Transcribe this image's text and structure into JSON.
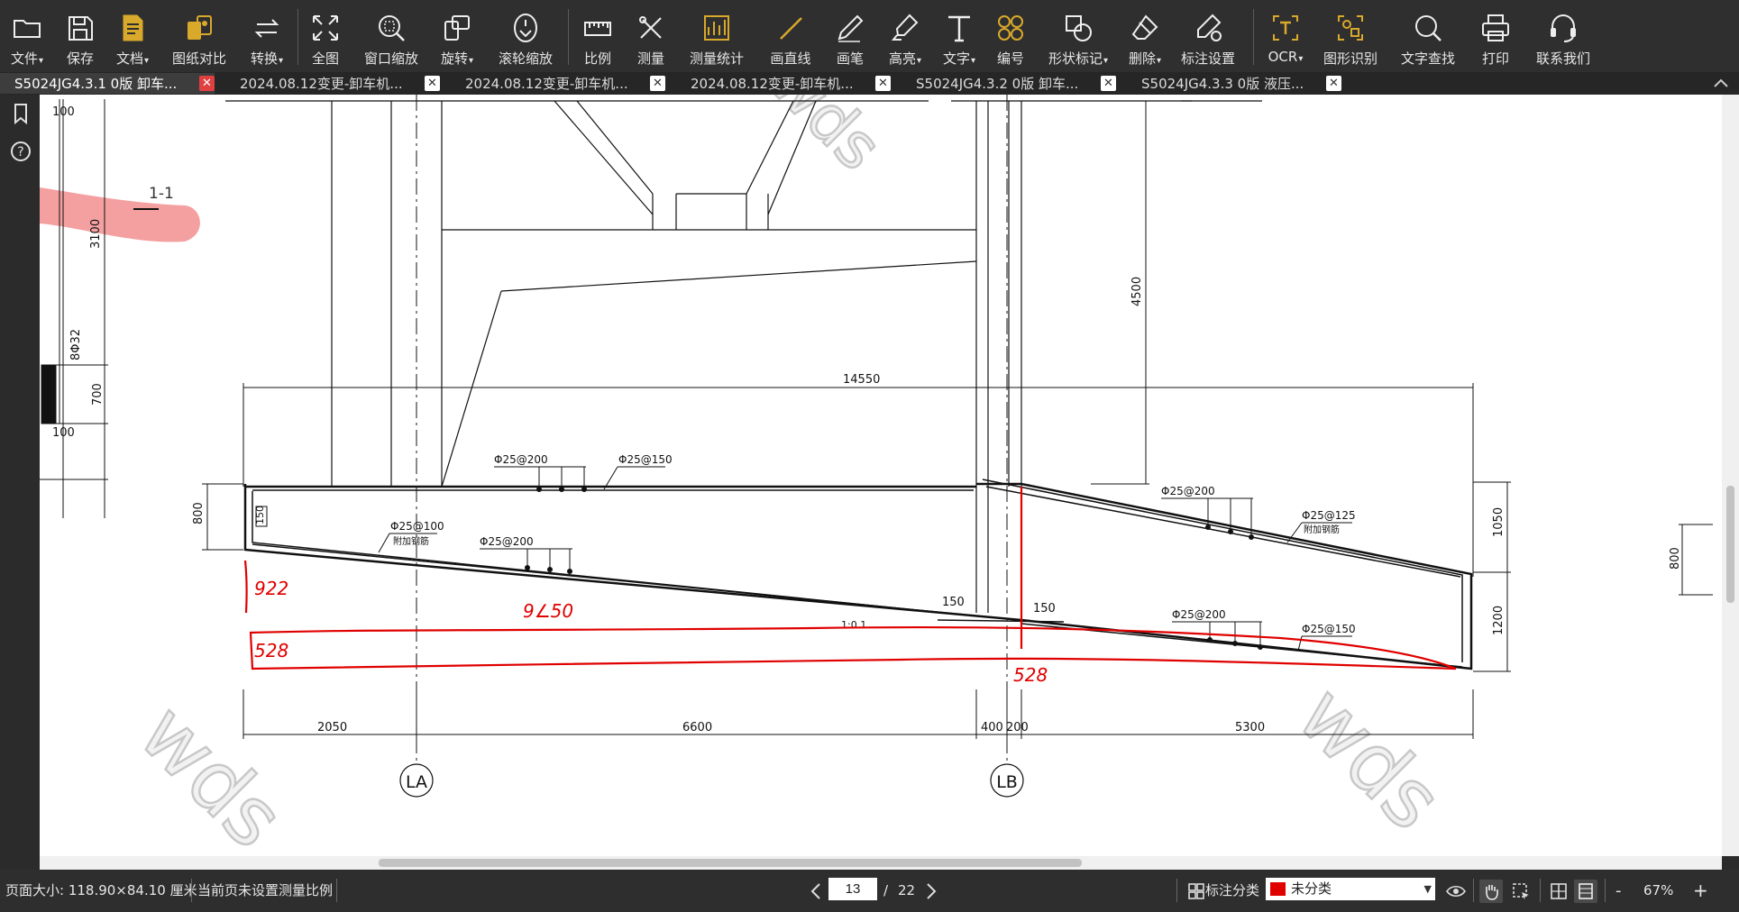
{
  "toolbar": {
    "buttons": [
      {
        "label": "文件",
        "icon": "folder-icon",
        "dropdown": true
      },
      {
        "label": "保存",
        "icon": "save-icon",
        "dropdown": false
      },
      {
        "label": "文档",
        "icon": "document-icon",
        "dropdown": true
      },
      {
        "label": "图纸对比",
        "icon": "compare-icon",
        "dropdown": false
      },
      {
        "label": "转换",
        "icon": "convert-icon",
        "dropdown": true
      },
      {
        "label": "全图",
        "icon": "fit-all-icon",
        "dropdown": false
      },
      {
        "label": "窗口缩放",
        "icon": "window-zoom-icon",
        "dropdown": false
      },
      {
        "label": "旋转",
        "icon": "rotate-icon",
        "dropdown": true
      },
      {
        "label": "滚轮缩放",
        "icon": "mouse-wheel-icon",
        "dropdown": false
      },
      {
        "label": "比例",
        "icon": "scale-ruler-icon",
        "dropdown": false
      },
      {
        "label": "测量",
        "icon": "measure-icon",
        "dropdown": false
      },
      {
        "label": "测量统计",
        "icon": "measure-stats-icon",
        "dropdown": false
      },
      {
        "label": "画直线",
        "icon": "line-icon",
        "dropdown": false
      },
      {
        "label": "画笔",
        "icon": "pen-icon",
        "dropdown": false
      },
      {
        "label": "高亮",
        "icon": "highlighter-icon",
        "dropdown": true
      },
      {
        "label": "文字",
        "icon": "text-icon",
        "dropdown": true
      },
      {
        "label": "编号",
        "icon": "numbering-icon",
        "dropdown": false
      },
      {
        "label": "形状标记",
        "icon": "shape-mark-icon",
        "dropdown": true
      },
      {
        "label": "删除",
        "icon": "eraser-icon",
        "dropdown": true
      },
      {
        "label": "标注设置",
        "icon": "annotation-settings-icon",
        "dropdown": false
      },
      {
        "label": "OCR",
        "icon": "ocr-icon",
        "dropdown": true
      },
      {
        "label": "图形识别",
        "icon": "shape-recognition-icon",
        "dropdown": false
      },
      {
        "label": "文字查找",
        "icon": "search-icon",
        "dropdown": false
      },
      {
        "label": "打印",
        "icon": "printer-icon",
        "dropdown": false
      },
      {
        "label": "联系我们",
        "icon": "headset-icon",
        "dropdown": false
      }
    ]
  },
  "tabs": [
    {
      "label": "S5024JG4.3.1 0版 卸车...",
      "active": true
    },
    {
      "label": "2024.08.12变更-卸车机...",
      "active": false
    },
    {
      "label": "2024.08.12变更-卸车机...",
      "active": false
    },
    {
      "label": "2024.08.12变更-卸车机...",
      "active": false
    },
    {
      "label": "S5024JG4.3.2 0版 卸车...",
      "active": false
    },
    {
      "label": "S5024JG4.3.3 0版 液压...",
      "active": false
    }
  ],
  "drawing": {
    "section_label": "1-1",
    "dims": {
      "total_width": "14550",
      "left_span": "2050",
      "mid_span": "6600",
      "col_width": "400",
      "gap": "200",
      "right_span": "5300",
      "height_top": "4500",
      "left_h": "800",
      "right_h1": "1050",
      "right_h2": "1200",
      "far_right": "800",
      "d150a": "150",
      "d150b": "150",
      "d150c": "150",
      "slope": "1:0.1",
      "left_top": "100",
      "left_3100": "3100",
      "left_832": "8Φ32",
      "left_700": "700",
      "left_100b": "100"
    },
    "rebar": {
      "r1": "Φ25@200",
      "r2": "Φ25@150",
      "r3": "Φ25@100",
      "r3b": "附加钢筋",
      "r4": "Φ25@200",
      "r5": "Φ25@200",
      "r6": "Φ25@125",
      "r6b": "附加钢筋",
      "r7": "Φ25@200",
      "r8": "Φ25@150"
    },
    "axes": {
      "a": "LA",
      "b": "LB"
    },
    "handwritten": {
      "h1": "922",
      "h2": "9∠50",
      "h3": "528",
      "h4": "528"
    },
    "watermark": "wds",
    "colors": {
      "markup": "#e00000",
      "highlight": "#f4a0a0"
    }
  },
  "status": {
    "page_size": "页面大小: 118.90×84.10 厘米",
    "scale_info": "当前页未设置测量比例",
    "current_page": "13",
    "page_sep": "/",
    "total_pages": "22",
    "category_label": "标注分类",
    "category_value": "未分类",
    "zoom": "67%",
    "zoom_minus": "-",
    "zoom_plus": "+"
  }
}
